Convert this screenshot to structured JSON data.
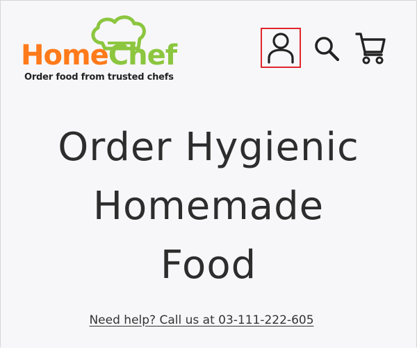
{
  "header": {
    "logo": {
      "brand_part1": "Home",
      "brand_part2": "Chef",
      "tagline": "Order food from trusted chefs",
      "icon": "chef-hat-icon"
    },
    "icons": [
      {
        "name": "account",
        "icon": "user-icon",
        "highlighted": true
      },
      {
        "name": "search",
        "icon": "search-icon"
      },
      {
        "name": "cart",
        "icon": "cart-icon"
      }
    ]
  },
  "hero": {
    "title_line1": "Order Hygienic",
    "title_line2": "Homemade",
    "title_line3": "Food",
    "help_text": "Need help? Call us at 03-111-222-605"
  },
  "colors": {
    "brand_orange": "#ff7a1a",
    "brand_green": "#8cc63f",
    "highlight_red": "#e0242b",
    "text_dark": "#2d2d2d",
    "background": "#f7f7f9"
  }
}
